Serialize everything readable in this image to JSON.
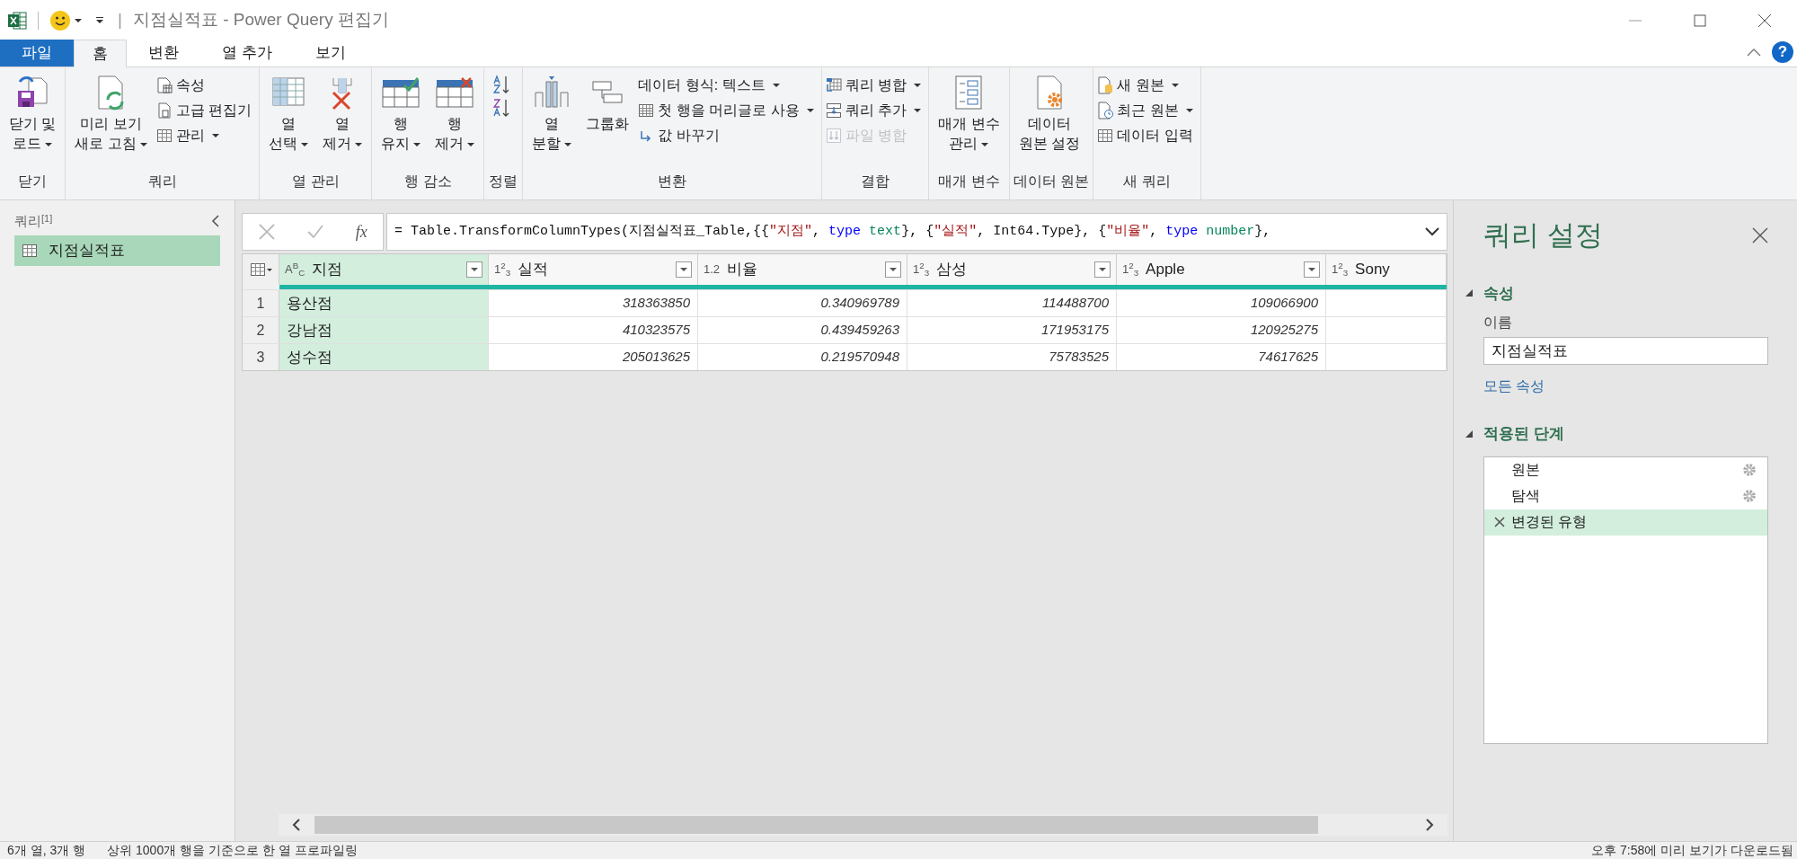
{
  "window": {
    "title": "지점실적표 - Power Query 편집기",
    "separator": "|"
  },
  "tabs": [
    {
      "label": "파일",
      "kind": "file"
    },
    {
      "label": "홈",
      "kind": "tab",
      "selected": true
    },
    {
      "label": "변환",
      "kind": "tab",
      "selected": false
    },
    {
      "label": "열 추가",
      "kind": "tab",
      "selected": false
    },
    {
      "label": "보기",
      "kind": "tab",
      "selected": false
    }
  ],
  "help": "?",
  "ribbon": {
    "groups": [
      {
        "label": "닫기",
        "items": [
          {
            "kind": "large",
            "label": "닫기 및\n로드",
            "dropdown": true
          }
        ]
      },
      {
        "label": "쿼리",
        "items": [
          {
            "kind": "large",
            "label": "미리 보기\n새로 고침",
            "dropdown": true
          },
          {
            "kind": "small",
            "label": "속성",
            "dropdown": false
          },
          {
            "kind": "small",
            "label": "고급 편집기",
            "dropdown": false
          },
          {
            "kind": "small",
            "label": "관리",
            "dropdown": true
          }
        ]
      },
      {
        "label": "열 관리",
        "items": [
          {
            "kind": "large",
            "label": "열\n선택",
            "dropdown": true
          },
          {
            "kind": "large",
            "label": "열\n제거",
            "dropdown": true
          }
        ]
      },
      {
        "label": "행 감소",
        "items": [
          {
            "kind": "large",
            "label": "행\n유지",
            "dropdown": true
          },
          {
            "kind": "large",
            "label": "행\n제거",
            "dropdown": true
          }
        ]
      },
      {
        "label": "정렬",
        "items": [
          {
            "kind": "icon"
          },
          {
            "kind": "icon"
          }
        ]
      },
      {
        "label": "변환",
        "items": [
          {
            "kind": "large",
            "label": "열\n분할",
            "dropdown": true
          },
          {
            "kind": "large",
            "label": "그룹화",
            "dropdown": false
          },
          {
            "kind": "small",
            "label": "데이터 형식: 텍스트",
            "dropdown": true
          },
          {
            "kind": "small",
            "label": "첫 행을 머리글로 사용",
            "dropdown": true
          },
          {
            "kind": "small",
            "label": "값 바꾸기",
            "dropdown": false
          }
        ]
      },
      {
        "label": "결합",
        "items": [
          {
            "kind": "small",
            "label": "쿼리 병합",
            "dropdown": true
          },
          {
            "kind": "small",
            "label": "쿼리 추가",
            "dropdown": true
          },
          {
            "kind": "small",
            "label": "파일 병합",
            "dropdown": false,
            "disabled": true
          }
        ]
      },
      {
        "label": "매개 변수",
        "items": [
          {
            "kind": "large",
            "label": "매개 변수\n관리",
            "dropdown": true
          }
        ]
      },
      {
        "label": "데이터 원본",
        "items": [
          {
            "kind": "large",
            "label": "데이터\n원본 설정",
            "dropdown": false
          }
        ]
      },
      {
        "label": "새 쿼리",
        "items": [
          {
            "kind": "small",
            "label": "새 원본",
            "dropdown": true
          },
          {
            "kind": "small",
            "label": "최근 원본",
            "dropdown": true
          },
          {
            "kind": "small",
            "label": "데이터 입력",
            "dropdown": false
          }
        ]
      }
    ]
  },
  "queries_pane": {
    "title": "쿼리",
    "count": "[1]",
    "items": [
      {
        "label": "지점실적표",
        "selected": true
      }
    ]
  },
  "formula_bar": {
    "fx": "fx",
    "segments": [
      {
        "kind": "plain",
        "text": "= Table.TransformColumnTypes(지점실적표_Table,{{"
      },
      {
        "kind": "string",
        "text": "\"지점\""
      },
      {
        "kind": "plain",
        "text": ", "
      },
      {
        "kind": "keyword",
        "text": "type"
      },
      {
        "kind": "type",
        "text": " text"
      },
      {
        "kind": "plain",
        "text": "}, {"
      },
      {
        "kind": "string",
        "text": "\"실적\""
      },
      {
        "kind": "plain",
        "text": ", Int64.Type}, {"
      },
      {
        "kind": "string",
        "text": "\"비율\""
      },
      {
        "kind": "plain",
        "text": ", "
      },
      {
        "kind": "keyword",
        "text": "type"
      },
      {
        "kind": "type",
        "text": " number"
      },
      {
        "kind": "plain",
        "text": "},"
      }
    ]
  },
  "table": {
    "columns": [
      {
        "type_icon": "A$^{B}$$_{C}$",
        "name": "지점",
        "kind": "text",
        "selected": true
      },
      {
        "type_icon": "1$^{2}$$_{3}$",
        "name": "실적",
        "kind": "number",
        "selected": false
      },
      {
        "type_icon": "1.2",
        "name": "비율",
        "kind": "number",
        "selected": false
      },
      {
        "type_icon": "1$^{2}$$_{3}$",
        "name": "삼성",
        "kind": "number",
        "selected": false
      },
      {
        "type_icon": "1$^{2}$$_{3}$",
        "name": "Apple",
        "kind": "number",
        "selected": false
      },
      {
        "type_icon": "1$^{2}$$_{3}$",
        "name": "Sony",
        "kind": "number",
        "selected": false
      }
    ],
    "rows": [
      {
        "number": "1",
        "cells": [
          "용산점",
          "318363850",
          "0.340969789",
          "114488700",
          "109066900"
        ]
      },
      {
        "number": "2",
        "cells": [
          "강남점",
          "410323575",
          "0.439459263",
          "171953175",
          "120925275"
        ]
      },
      {
        "number": "3",
        "cells": [
          "성수점",
          "205013625",
          "0.219570948",
          "75783525",
          "74617625"
        ]
      }
    ]
  },
  "settings_pane": {
    "title": "쿼리 설정",
    "properties": {
      "heading": "속성",
      "name_label": "이름",
      "name_value": "지점실적표",
      "all_properties_link": "모든 속성"
    },
    "steps": {
      "heading": "적용된 단계",
      "items": [
        {
          "label": "원본",
          "settings": true,
          "selected": false
        },
        {
          "label": "탐색",
          "settings": true,
          "selected": false
        },
        {
          "label": "변경된 유형",
          "settings": false,
          "selected": true
        }
      ]
    }
  },
  "status_bar": {
    "left": [
      "6개 열, 3개 행",
      "상위 1000개 행을 기준으로 한 열 프로파일링"
    ],
    "right": "오후 7:58에 미리 보기가 다운로드됨"
  }
}
